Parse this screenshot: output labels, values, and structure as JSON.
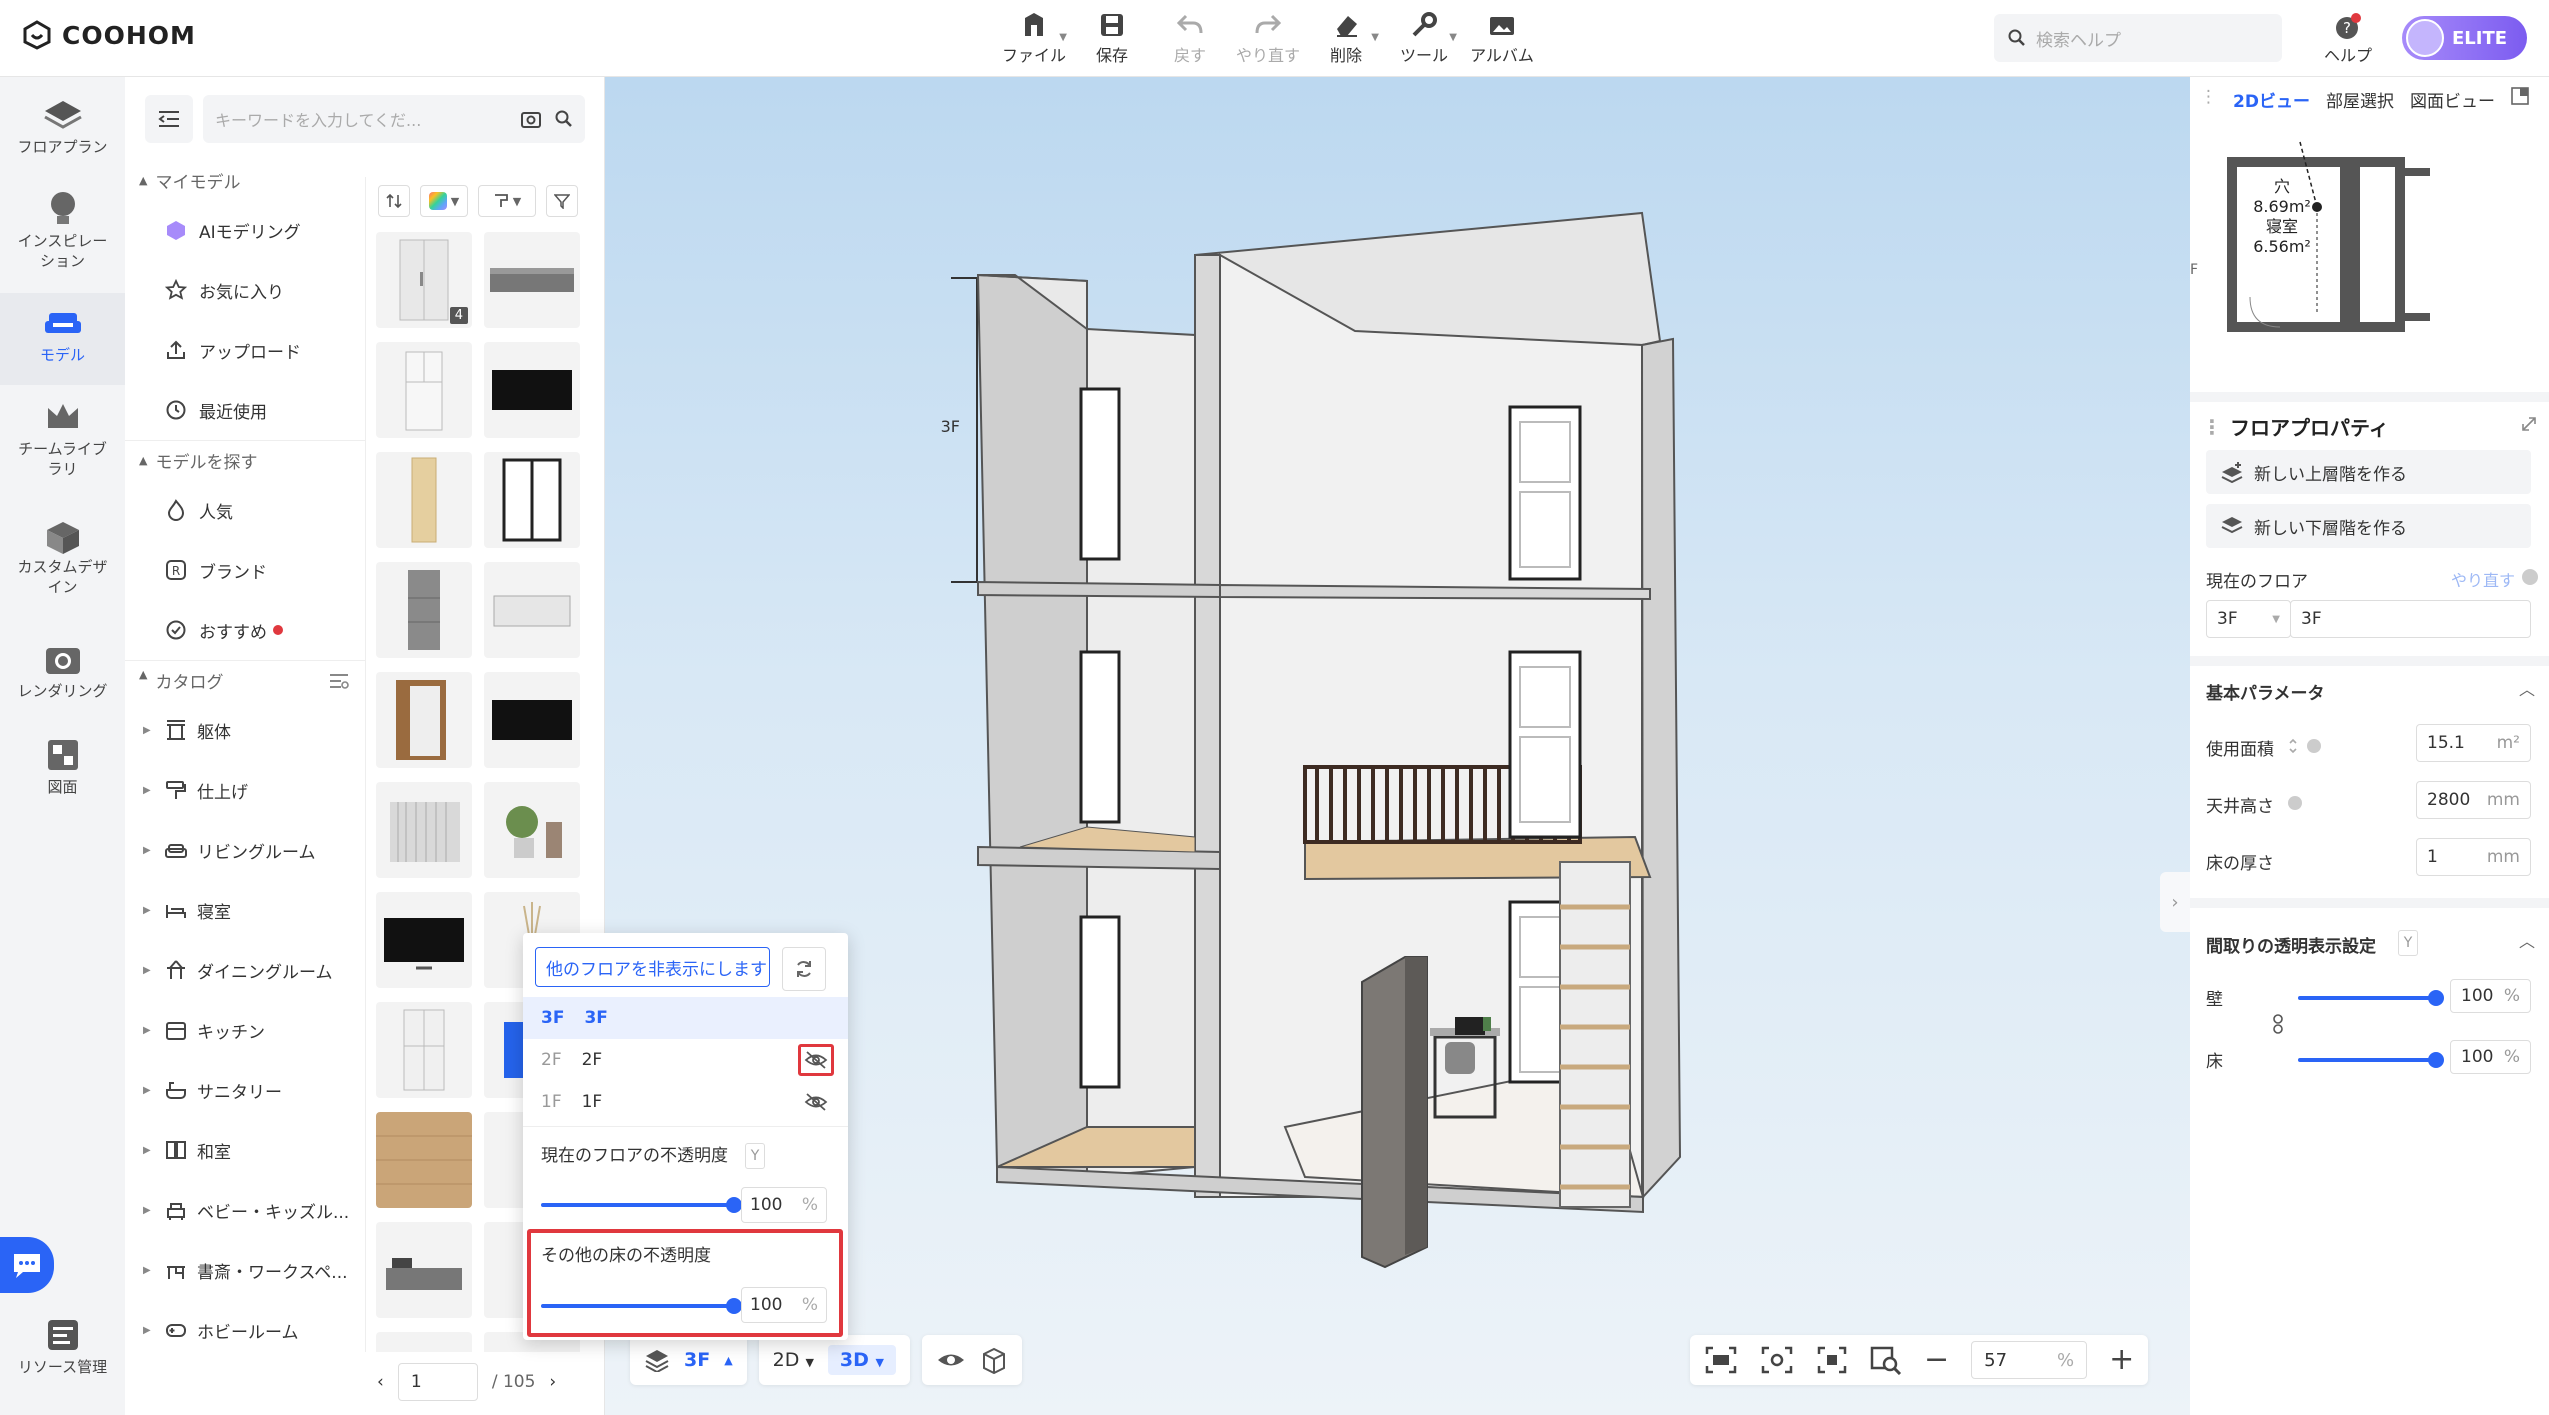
{
  "app": {
    "brand": "COOHOM",
    "accent": "#2a64f6",
    "alert": "#e0383e"
  },
  "toolbar": {
    "items": [
      {
        "label": "ファイル",
        "icon": "file-icon"
      },
      {
        "label": "保存",
        "icon": "save-icon"
      },
      {
        "label": "戻す",
        "icon": "undo-icon"
      },
      {
        "label": "やり直す",
        "icon": "redo-icon"
      },
      {
        "label": "削除",
        "icon": "eraser-icon"
      },
      {
        "label": "ツール",
        "icon": "wrench-icon"
      },
      {
        "label": "アルバム",
        "icon": "album-icon"
      }
    ],
    "search_placeholder": "検索ヘルプ",
    "help_label": "ヘルプ",
    "plan_label": "ELITE"
  },
  "leftnav": {
    "items": [
      {
        "label": "フロアプラン"
      },
      {
        "label": "インスピレーション"
      },
      {
        "label": "モデル"
      },
      {
        "label": "チームライブラリ"
      },
      {
        "label": "カスタムデザイン"
      },
      {
        "label": "レンダリング"
      },
      {
        "label": "図面"
      }
    ],
    "resource_label": "リソース管理"
  },
  "library": {
    "search_placeholder": "キーワードを入力してくだ...",
    "my_models_label": "マイモデル",
    "my_models": [
      "AIモデリング",
      "お気に入り",
      "アップロード",
      "最近使用"
    ],
    "explore_label": "モデルを探す",
    "explore": [
      "人気",
      "ブランド",
      "おすすめ"
    ],
    "catalog_label": "カタログ",
    "catalog": [
      "躯体",
      "仕上げ",
      "リビングルーム",
      "寝室",
      "ダイニングルーム",
      "キッチン",
      "サニタリー",
      "和室",
      "ベビー・キッズル...",
      "書斎・ワークスペ...",
      "ホビールーム"
    ],
    "badge_count": "4",
    "page_current": "1",
    "page_total": "/ 105"
  },
  "floor_popup": {
    "hide_others_label": "他のフロアを非表示にします",
    "floors": [
      {
        "id": "3F",
        "name": "3F"
      },
      {
        "id": "2F",
        "name": "2F"
      },
      {
        "id": "1F",
        "name": "1F"
      }
    ],
    "current_opacity_label": "現在のフロアの不透明度",
    "current_opacity_value": "100",
    "other_opacity_label": "その他の床の不透明度",
    "other_opacity_value": "100",
    "unit": "%",
    "y_badge": "Y"
  },
  "canvas": {
    "floor_marker": "3F"
  },
  "bottombar": {
    "floor": "3F",
    "view_2d": "2D",
    "view_3d": "3D",
    "zoom": "57",
    "zoom_unit": "%"
  },
  "minimap": {
    "tabs": [
      "2Dビュー",
      "部屋選択",
      "図面ビュー"
    ],
    "room1": "穴",
    "area1": "8.69m²",
    "room2": "寝室",
    "area2": "6.56m²",
    "edge_label": "F"
  },
  "props": {
    "title": "フロアプロパティ",
    "btn_upper": "新しい上層階を作る",
    "btn_lower": "新しい下層階を作る",
    "current_floor_label": "現在のフロア",
    "redo_label": "やり直す",
    "floor_code": "3F",
    "floor_name": "3F",
    "basic_params_label": "基本パラメータ",
    "area_label": "使用面積",
    "area_value": "15.1",
    "area_unit": "m²",
    "ceiling_label": "天井高さ",
    "ceiling_value": "2800",
    "ceiling_unit": "mm",
    "thickness_label": "床の厚さ",
    "thickness_value": "1",
    "thickness_unit": "mm",
    "transparency_label": "間取りの透明表示設定",
    "y_badge": "Y",
    "wall_label": "壁",
    "wall_value": "100",
    "floor_label": "床",
    "floor_value": "100",
    "pct": "%"
  }
}
